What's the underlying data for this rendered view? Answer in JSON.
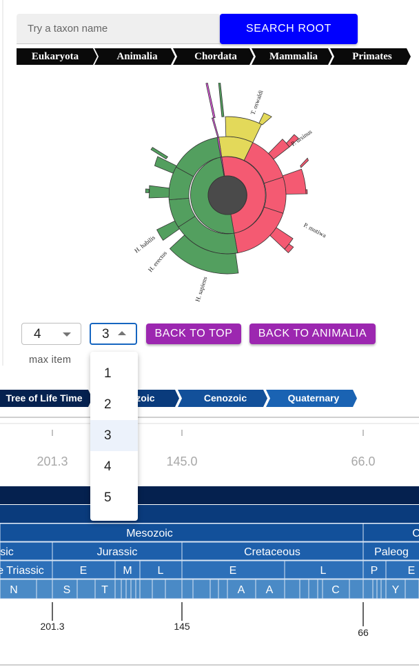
{
  "search": {
    "placeholder": "Try a taxon name",
    "button": "SEARCH ROOT"
  },
  "taxon_breadcrumb": [
    "Eukaryota",
    "Animalia",
    "Chordata",
    "Mammalia",
    "Primates"
  ],
  "sunburst": {
    "labels": [
      "T. oswaldi",
      "P. ursinus",
      "P. mutiwa",
      "H. sapiens",
      "H. erectus",
      "H. habilis"
    ],
    "colors": {
      "yellow": "#e3d95a",
      "red": "#f45a72",
      "green": "#539f5f",
      "magenta": "#d95ad9",
      "center": "#4a4a4a"
    }
  },
  "controls": {
    "max_item_value": "4",
    "max_item_label": "max item",
    "depth_value": "3",
    "back_to_top": "BACK TO TOP",
    "back_to_parent": "BACK TO ANIMALIA"
  },
  "depth_options": [
    "1",
    "2",
    "3",
    "4",
    "5"
  ],
  "depth_selected": "3",
  "time_breadcrumb": [
    "Tree of Life Time",
    "Mesozoic",
    "Cenozoic",
    "Quaternary"
  ],
  "timeline": {
    "ticks_top": [
      "201.3",
      "145.0",
      "66.0"
    ],
    "ticks_bottom": [
      "201.3",
      "145",
      "66"
    ],
    "era_row": [
      "Mesozoic",
      "C"
    ],
    "period_row": [
      "sic",
      "Jurassic",
      "Cretaceous",
      "Paleog"
    ],
    "epoch_row": [
      "e Triassic",
      "E",
      "M",
      "L",
      "E",
      "L",
      "P",
      "E"
    ],
    "stage_row": [
      "N",
      "S",
      "T",
      "A",
      "A",
      "C",
      "Y"
    ],
    "colors": {
      "eon": "#05214f",
      "era": "#0a3b7c",
      "period": "#1856a3",
      "epoch": "#2d70b9",
      "stage": "#4a8ac6"
    }
  }
}
